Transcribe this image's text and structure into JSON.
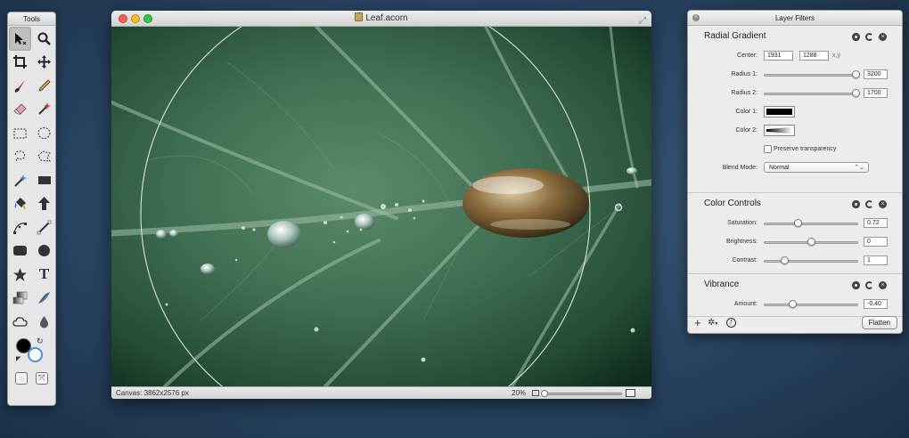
{
  "tools_panel": {
    "title": "Tools",
    "tools": [
      {
        "icon": "arrow-select-icon",
        "active": true
      },
      {
        "icon": "zoom-icon"
      },
      {
        "icon": "crop-icon"
      },
      {
        "icon": "move-icon"
      },
      {
        "icon": "brush-icon"
      },
      {
        "icon": "pencil-icon"
      },
      {
        "icon": "eraser-icon"
      },
      {
        "icon": "magic-wand-red-icon"
      },
      {
        "icon": "rect-select-icon"
      },
      {
        "icon": "ellipse-select-icon"
      },
      {
        "icon": "lasso-icon"
      },
      {
        "icon": "polygon-lasso-icon"
      },
      {
        "icon": "magic-wand-icon"
      },
      {
        "icon": "rectangle-shape-icon"
      },
      {
        "icon": "paint-bucket-icon"
      },
      {
        "icon": "arrow-up-shape-icon"
      },
      {
        "icon": "bezier-icon"
      },
      {
        "icon": "line-icon"
      },
      {
        "icon": "rounded-rect-icon"
      },
      {
        "icon": "circle-shape-icon"
      },
      {
        "icon": "star-icon"
      },
      {
        "icon": "text-icon"
      },
      {
        "icon": "gradient-icon"
      },
      {
        "icon": "smudge-icon"
      },
      {
        "icon": "cloud-icon"
      },
      {
        "icon": "drop-icon"
      }
    ],
    "text_tool_glyph": "T"
  },
  "document": {
    "title": "Leaf.acorn",
    "status_canvas": "Canvas: 3862x2576 px",
    "zoom": "20%",
    "zoom_fraction": 0.01
  },
  "filters_panel": {
    "title": "Layer Filters",
    "sections": {
      "radial": {
        "title": "Radial Gradient",
        "center_label": "Center:",
        "center_x": "1931",
        "center_y": "1288",
        "xy_label": "x,y",
        "radius1_label": "Radius 1:",
        "radius1_value": "3200",
        "radius1_fraction": 0.97,
        "radius2_label": "Radius 2:",
        "radius2_value": "1700",
        "radius2_fraction": 0.97,
        "color1_label": "Color 1:",
        "color2_label": "Color 2:",
        "preserve_label": "Preserve transparency",
        "blend_label": "Blend Mode:",
        "blend_value": "Normal",
        "blend_arrow": "⌃⌄"
      },
      "color_controls": {
        "title": "Color Controls",
        "saturation_label": "Saturation:",
        "saturation_value": "0.72",
        "saturation_fraction": 0.36,
        "brightness_label": "Brightness:",
        "brightness_value": "0",
        "brightness_fraction": 0.5,
        "contrast_label": "Contrast:",
        "contrast_value": "1",
        "contrast_fraction": 0.22
      },
      "vibrance": {
        "title": "Vibrance",
        "amount_label": "Amount:",
        "amount_value": "-0.40",
        "amount_fraction": 0.3
      }
    },
    "footer": {
      "add_glyph": "+",
      "gear_glyph": "✲",
      "gear_caret": "▾",
      "fx_glyph": "ƒ",
      "flatten_label": "Flatten"
    }
  }
}
